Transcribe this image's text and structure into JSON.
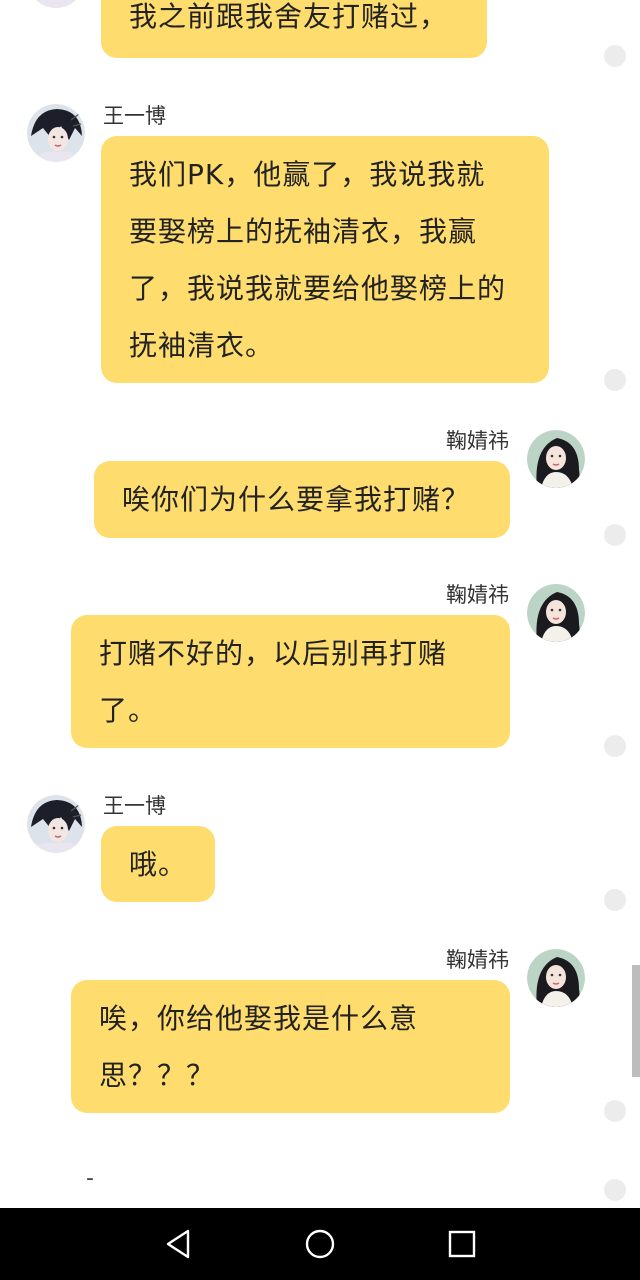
{
  "messages": [
    {
      "sender": "",
      "side": "left",
      "text": "我之前跟我舍友打赌过，"
    },
    {
      "sender": "王一博",
      "side": "left",
      "lines": [
        "我们PK，他赢了，我说我就",
        "要娶榜上的抚袖清衣，我赢",
        "了，我说我就要给他娶榜上的",
        "抚袖清衣。"
      ]
    },
    {
      "sender": "鞠婧祎",
      "side": "right",
      "text": "唉你们为什么要拿我打赌？"
    },
    {
      "sender": "鞠婧祎",
      "side": "right",
      "lines": [
        "打赌不好的，以后别再打赌",
        "了。"
      ]
    },
    {
      "sender": "王一博",
      "side": "left",
      "text": "哦。"
    },
    {
      "sender": "鞠婧祎",
      "side": "right",
      "lines": [
        "唉，你给他娶我是什么意",
        "思？？？"
      ]
    }
  ],
  "draft_text": "-",
  "navbar": {
    "back_icon": "triangle-back-icon",
    "home_icon": "circle-home-icon",
    "recents_icon": "square-recents-icon"
  },
  "colors": {
    "bubble": "#fedd6e",
    "background": "#ffffff",
    "navbar": "#000000"
  }
}
